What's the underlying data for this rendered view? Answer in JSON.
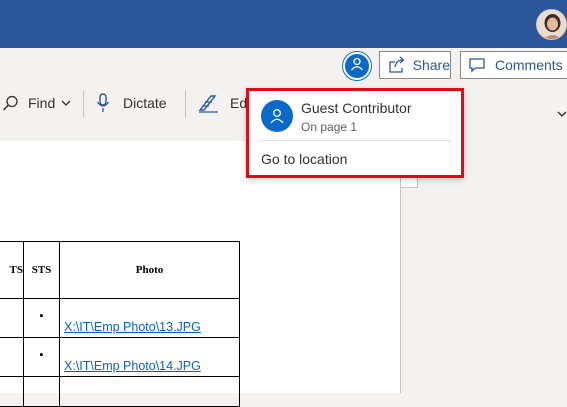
{
  "header": {
    "share_label": "Share",
    "comments_label": "Comments"
  },
  "ribbon": {
    "find_label": "Find",
    "dictate_label": "Dictate",
    "editor_label_partial": "Ed"
  },
  "popup": {
    "user_name": "Guest Contributor",
    "location": "On page 1",
    "action_label": "Go to location"
  },
  "table": {
    "headers": [
      "TS",
      "STS",
      "Photo"
    ],
    "rows": [
      {
        "bullet": "▪",
        "photo": "X:\\IT\\Emp Photo\\13.JPG"
      },
      {
        "bullet": "▪",
        "photo": "X:\\IT\\Emp Photo\\14.JPG"
      }
    ]
  },
  "colors": {
    "title_bar": "#2b579a",
    "accent": "#0b6ac9",
    "highlight_border": "#e00b16",
    "link": "#0563c1"
  },
  "icons": [
    "profile-avatar",
    "person-icon",
    "share-icon",
    "comment-icon",
    "search-icon",
    "chevron-down-icon",
    "microphone-icon",
    "editor-icon"
  ]
}
